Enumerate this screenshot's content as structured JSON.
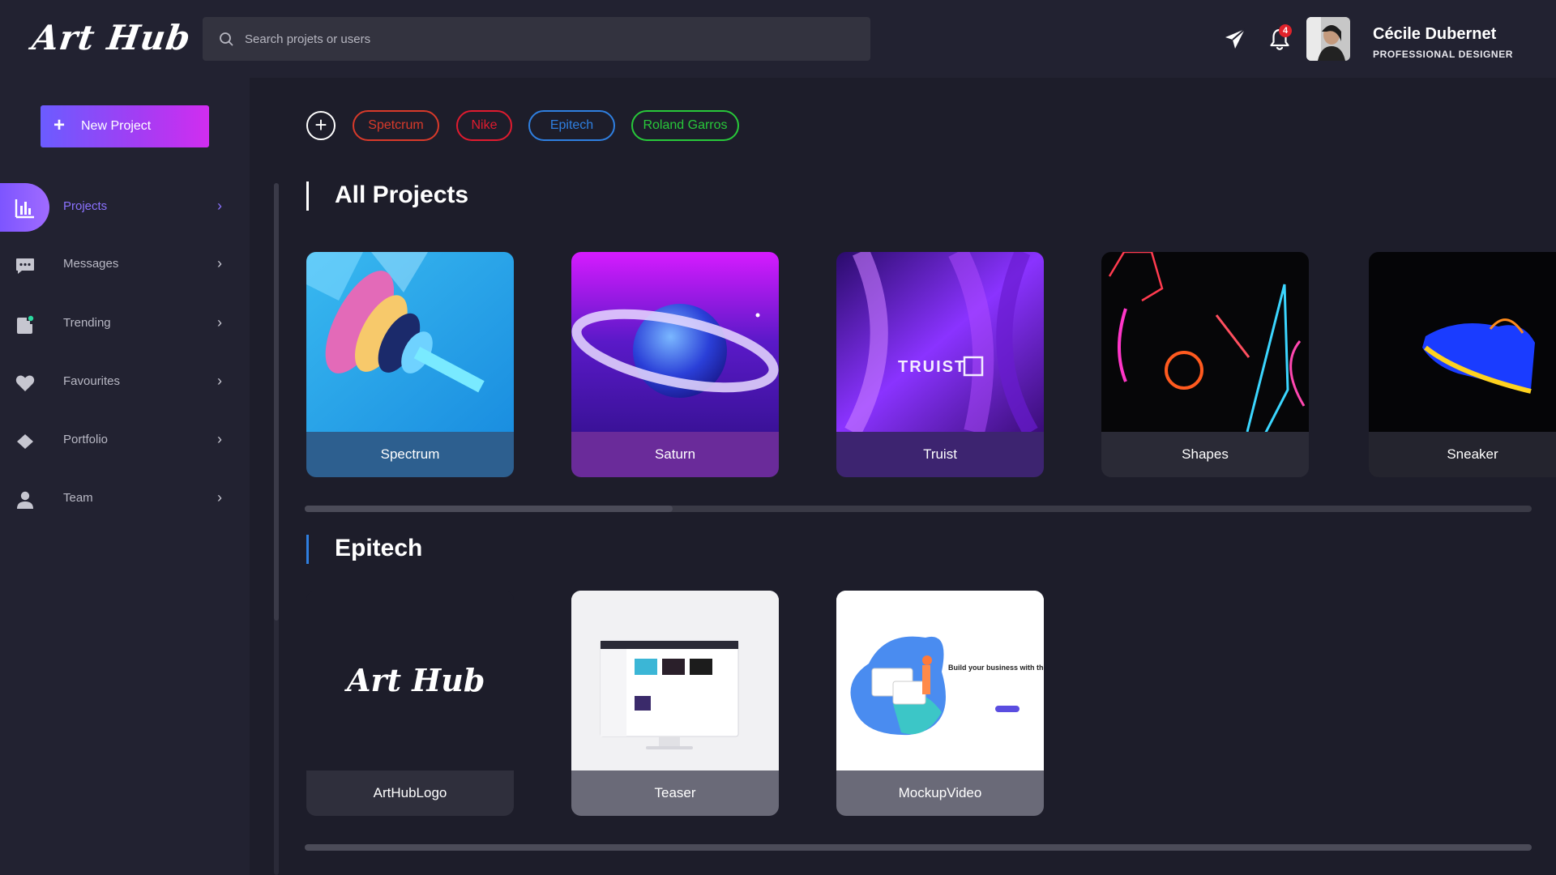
{
  "app": {
    "logo": "Art Hub"
  },
  "search": {
    "placeholder": "Search projets or users"
  },
  "notifications": {
    "count": "4"
  },
  "user": {
    "name": "Cécile Dubernet",
    "role": "PROFESSIONAL DESIGNER"
  },
  "sidebar": {
    "new_project_label": "New Project",
    "items": [
      {
        "label": "Projects",
        "icon": "bar-chart-icon",
        "active": true
      },
      {
        "label": "Messages",
        "icon": "chat-icon"
      },
      {
        "label": "Trending",
        "icon": "trending-icon"
      },
      {
        "label": "Favourites",
        "icon": "heart-icon"
      },
      {
        "label": "Portfolio",
        "icon": "diamond-icon"
      },
      {
        "label": "Team",
        "icon": "person-icon"
      }
    ]
  },
  "filters": {
    "tags": [
      {
        "label": "Spetcrum",
        "color": "#d83a2a"
      },
      {
        "label": "Nike",
        "color": "#e01b2f"
      },
      {
        "label": "Epitech",
        "color": "#2f7fe0"
      },
      {
        "label": "Roland Garros",
        "color": "#28c83a"
      }
    ]
  },
  "sections": [
    {
      "title": "All Projects",
      "accent": "#ffffff",
      "scroll_progress": 0.3,
      "projects": [
        {
          "label": "Spectrum"
        },
        {
          "label": "Saturn"
        },
        {
          "label": "Truist",
          "art_text": "TRUIST"
        },
        {
          "label": "Shapes"
        },
        {
          "label": "Sneaker"
        }
      ]
    },
    {
      "title": "Epitech",
      "accent": "#2f7fe0",
      "projects": [
        {
          "label": "ArtHubLogo",
          "art_text": "Art Hub"
        },
        {
          "label": "Teaser"
        },
        {
          "label": "MockupVideo",
          "art_text": "Build your business with the right plan"
        }
      ]
    }
  ]
}
